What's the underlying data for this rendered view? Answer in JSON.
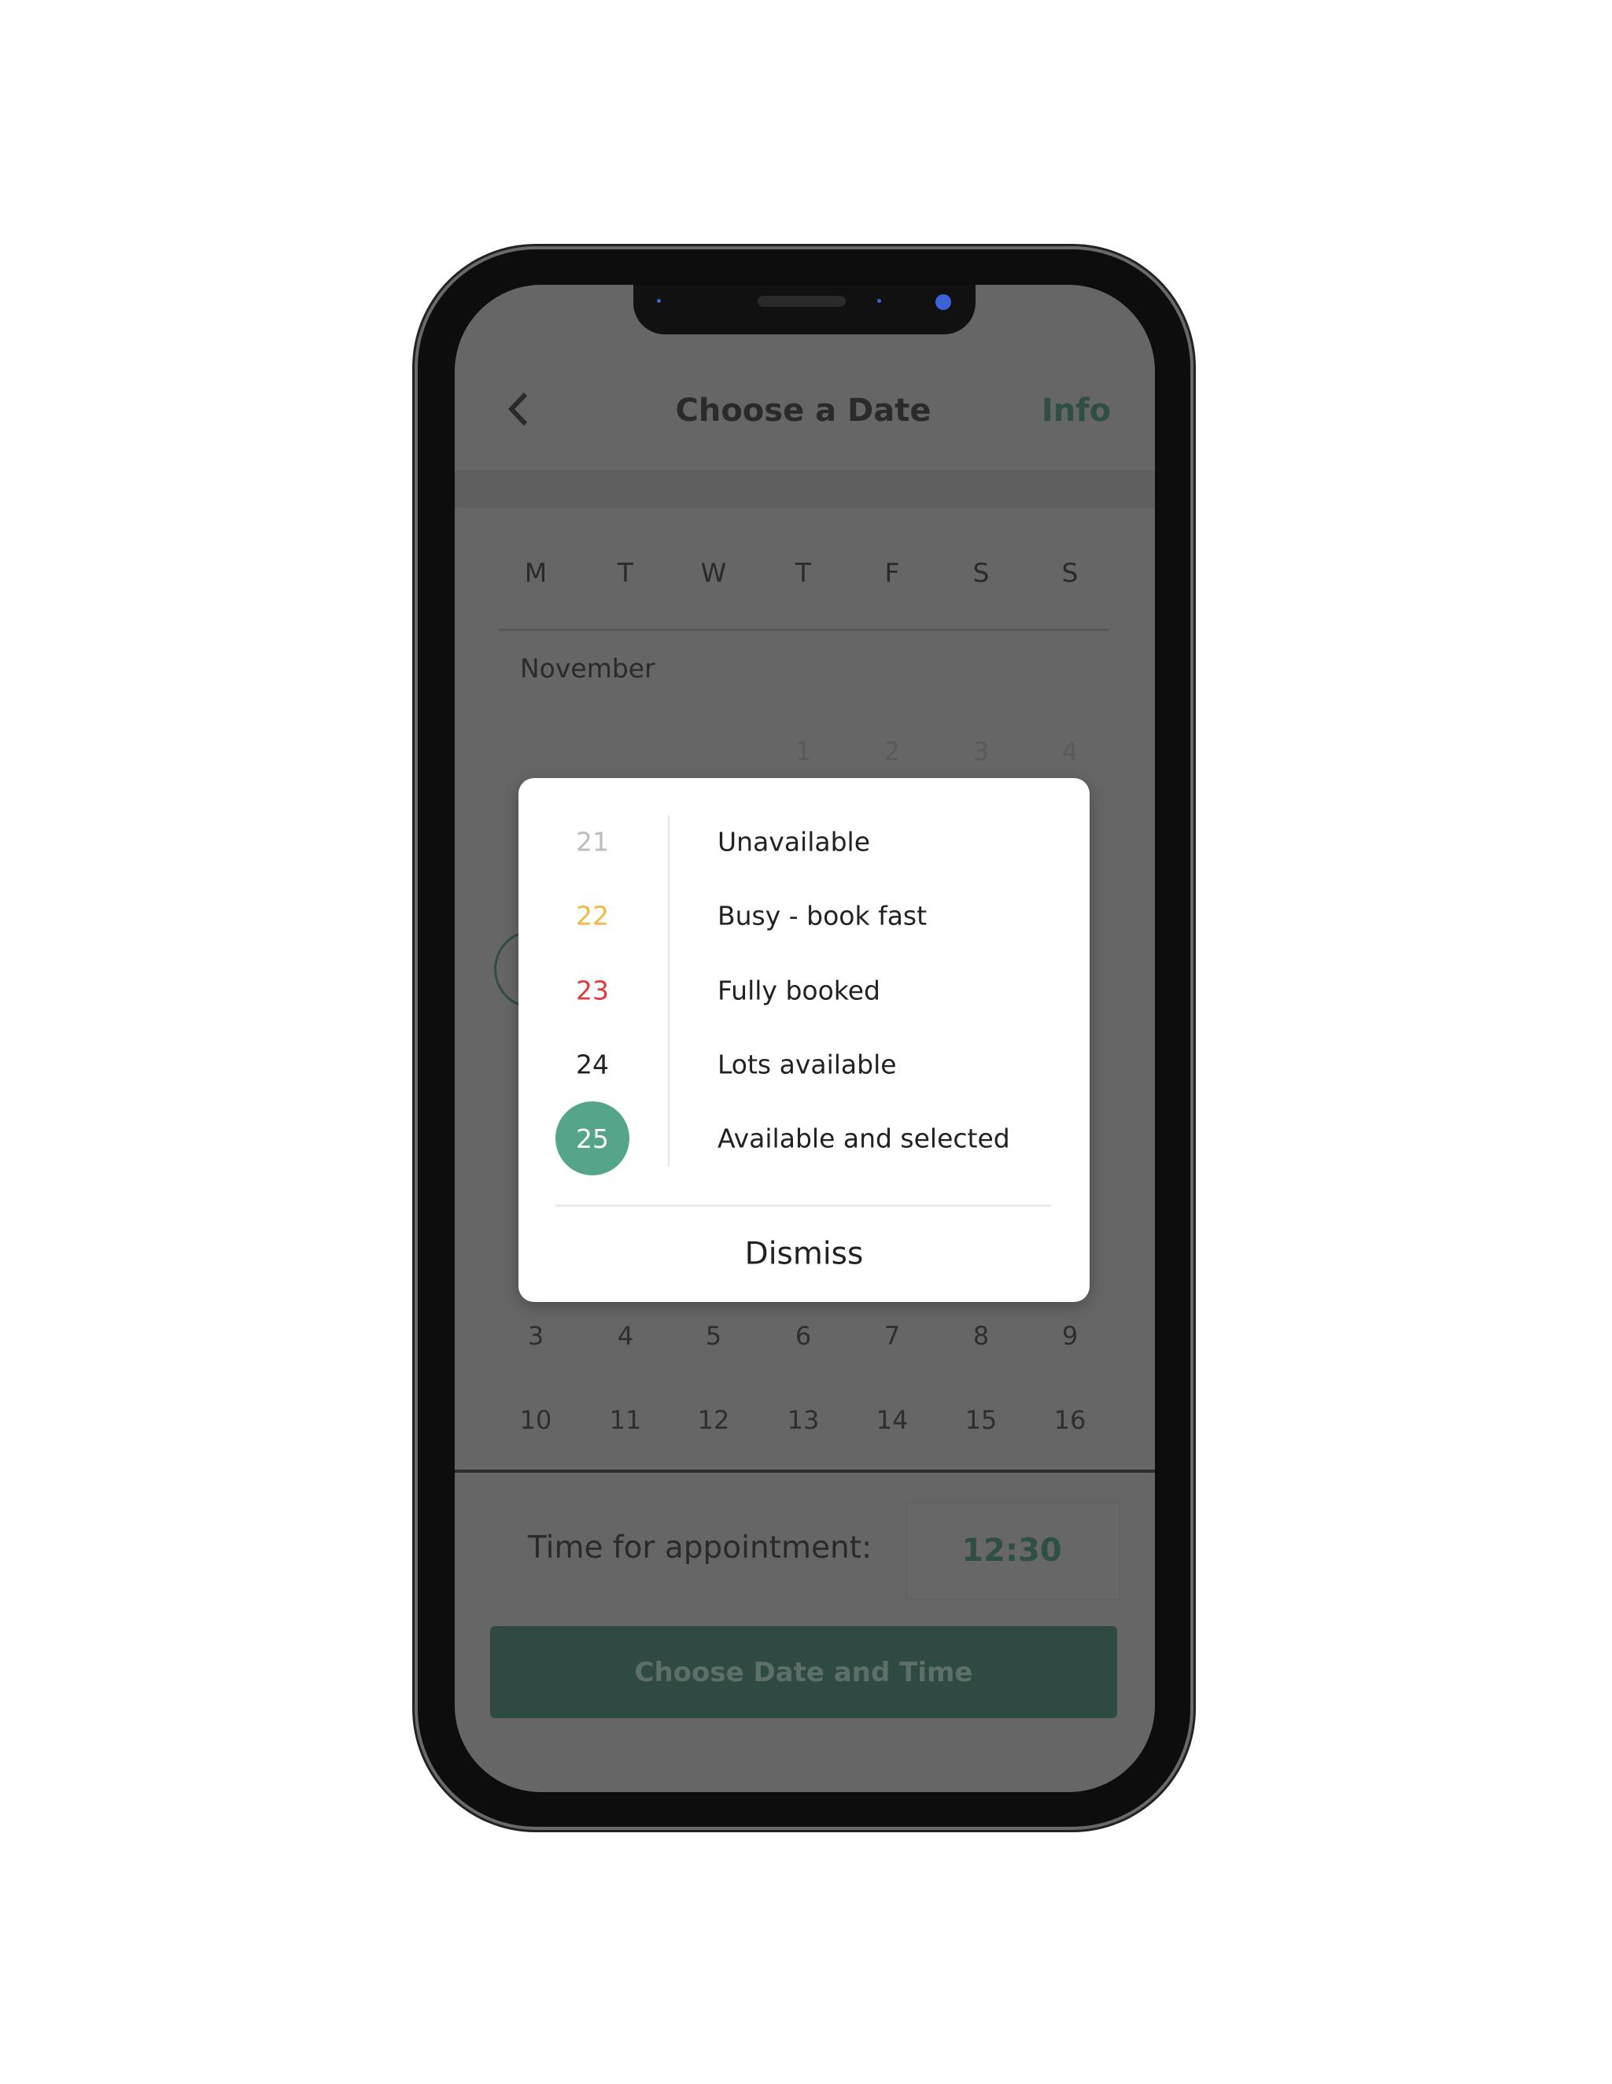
{
  "header": {
    "back_icon": "chevron-left-icon",
    "title": "Choose a Date",
    "info_label": "Info"
  },
  "calendar": {
    "weekdays": [
      "M",
      "T",
      "W",
      "T",
      "F",
      "S",
      "S"
    ],
    "month": "November",
    "row1": [
      "1",
      "2",
      "3",
      "4"
    ],
    "row_a": [
      "3",
      "4",
      "5",
      "6",
      "7",
      "8",
      "9"
    ],
    "row_b": [
      "10",
      "11",
      "12",
      "13",
      "14",
      "15",
      "16"
    ]
  },
  "legend": {
    "items": [
      {
        "day": "21",
        "label": "Unavailable",
        "color": "#bdbdbd"
      },
      {
        "day": "22",
        "label": "Busy - book fast",
        "color": "#f2b843"
      },
      {
        "day": "23",
        "label": "Fully booked",
        "color": "#e03b3b"
      },
      {
        "day": "24",
        "label": "Lots available",
        "color": "#222222"
      },
      {
        "day": "25",
        "label": "Available and selected",
        "color": "#55a58a"
      }
    ],
    "dismiss_label": "Dismiss"
  },
  "footer": {
    "time_label": "Time for appointment:",
    "time_value": "12:30",
    "cta_label": "Choose Date and Time"
  },
  "colors": {
    "accent": "#55a58a",
    "brand_dark": "#2f4a43",
    "overlay": "#666666"
  }
}
